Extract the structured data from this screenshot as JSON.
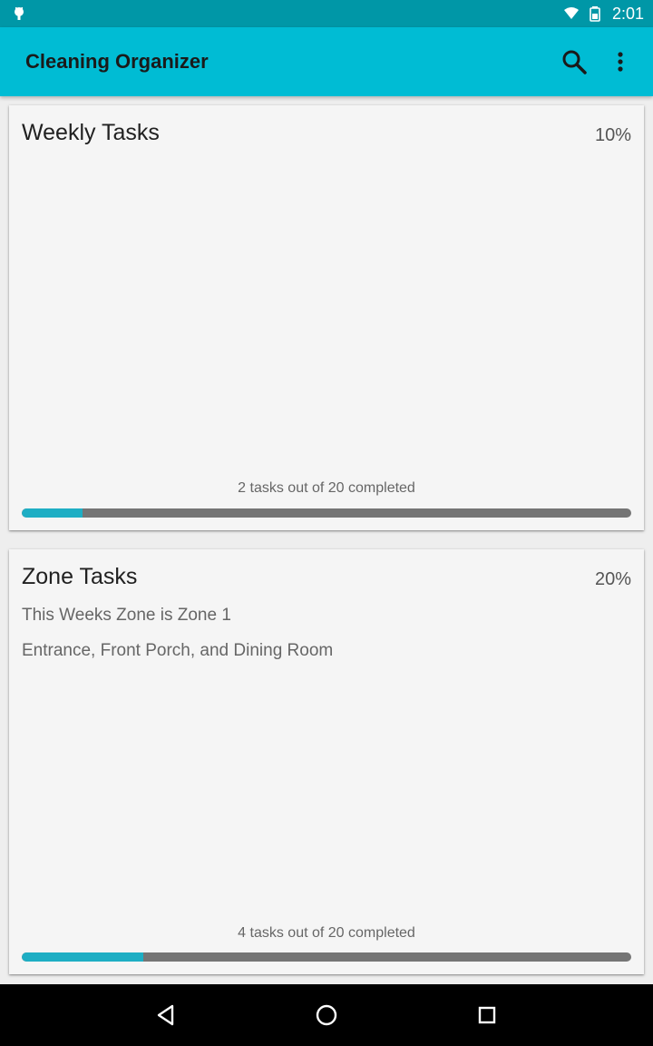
{
  "status_bar": {
    "time": "2:01",
    "icons": [
      "notification-bug-icon",
      "wifi-icon",
      "battery-icon"
    ]
  },
  "app_bar": {
    "title": "Cleaning Organizer",
    "actions": [
      "search-icon",
      "overflow-menu-icon"
    ],
    "color": "#00bcd4"
  },
  "weekly_card": {
    "title": "Weekly Tasks",
    "percent": "10%",
    "progress_text": "2 tasks out of 20 completed",
    "progress_fraction": 0.1
  },
  "zone_card": {
    "title": "Zone Tasks",
    "percent": "20%",
    "zone_line": "This Weeks Zone is Zone 1",
    "areas_line": "Entrance, Front Porch, and Dining Room",
    "progress_text": "4 tasks out of 20 completed",
    "progress_fraction": 0.2
  },
  "nav_bar": {
    "buttons": [
      "back-icon",
      "home-icon",
      "recents-icon"
    ]
  },
  "colors": {
    "status_bar": "#0097a7",
    "accent": "#1eaec4",
    "track": "#757575",
    "card_background": "#f5f5f5"
  }
}
